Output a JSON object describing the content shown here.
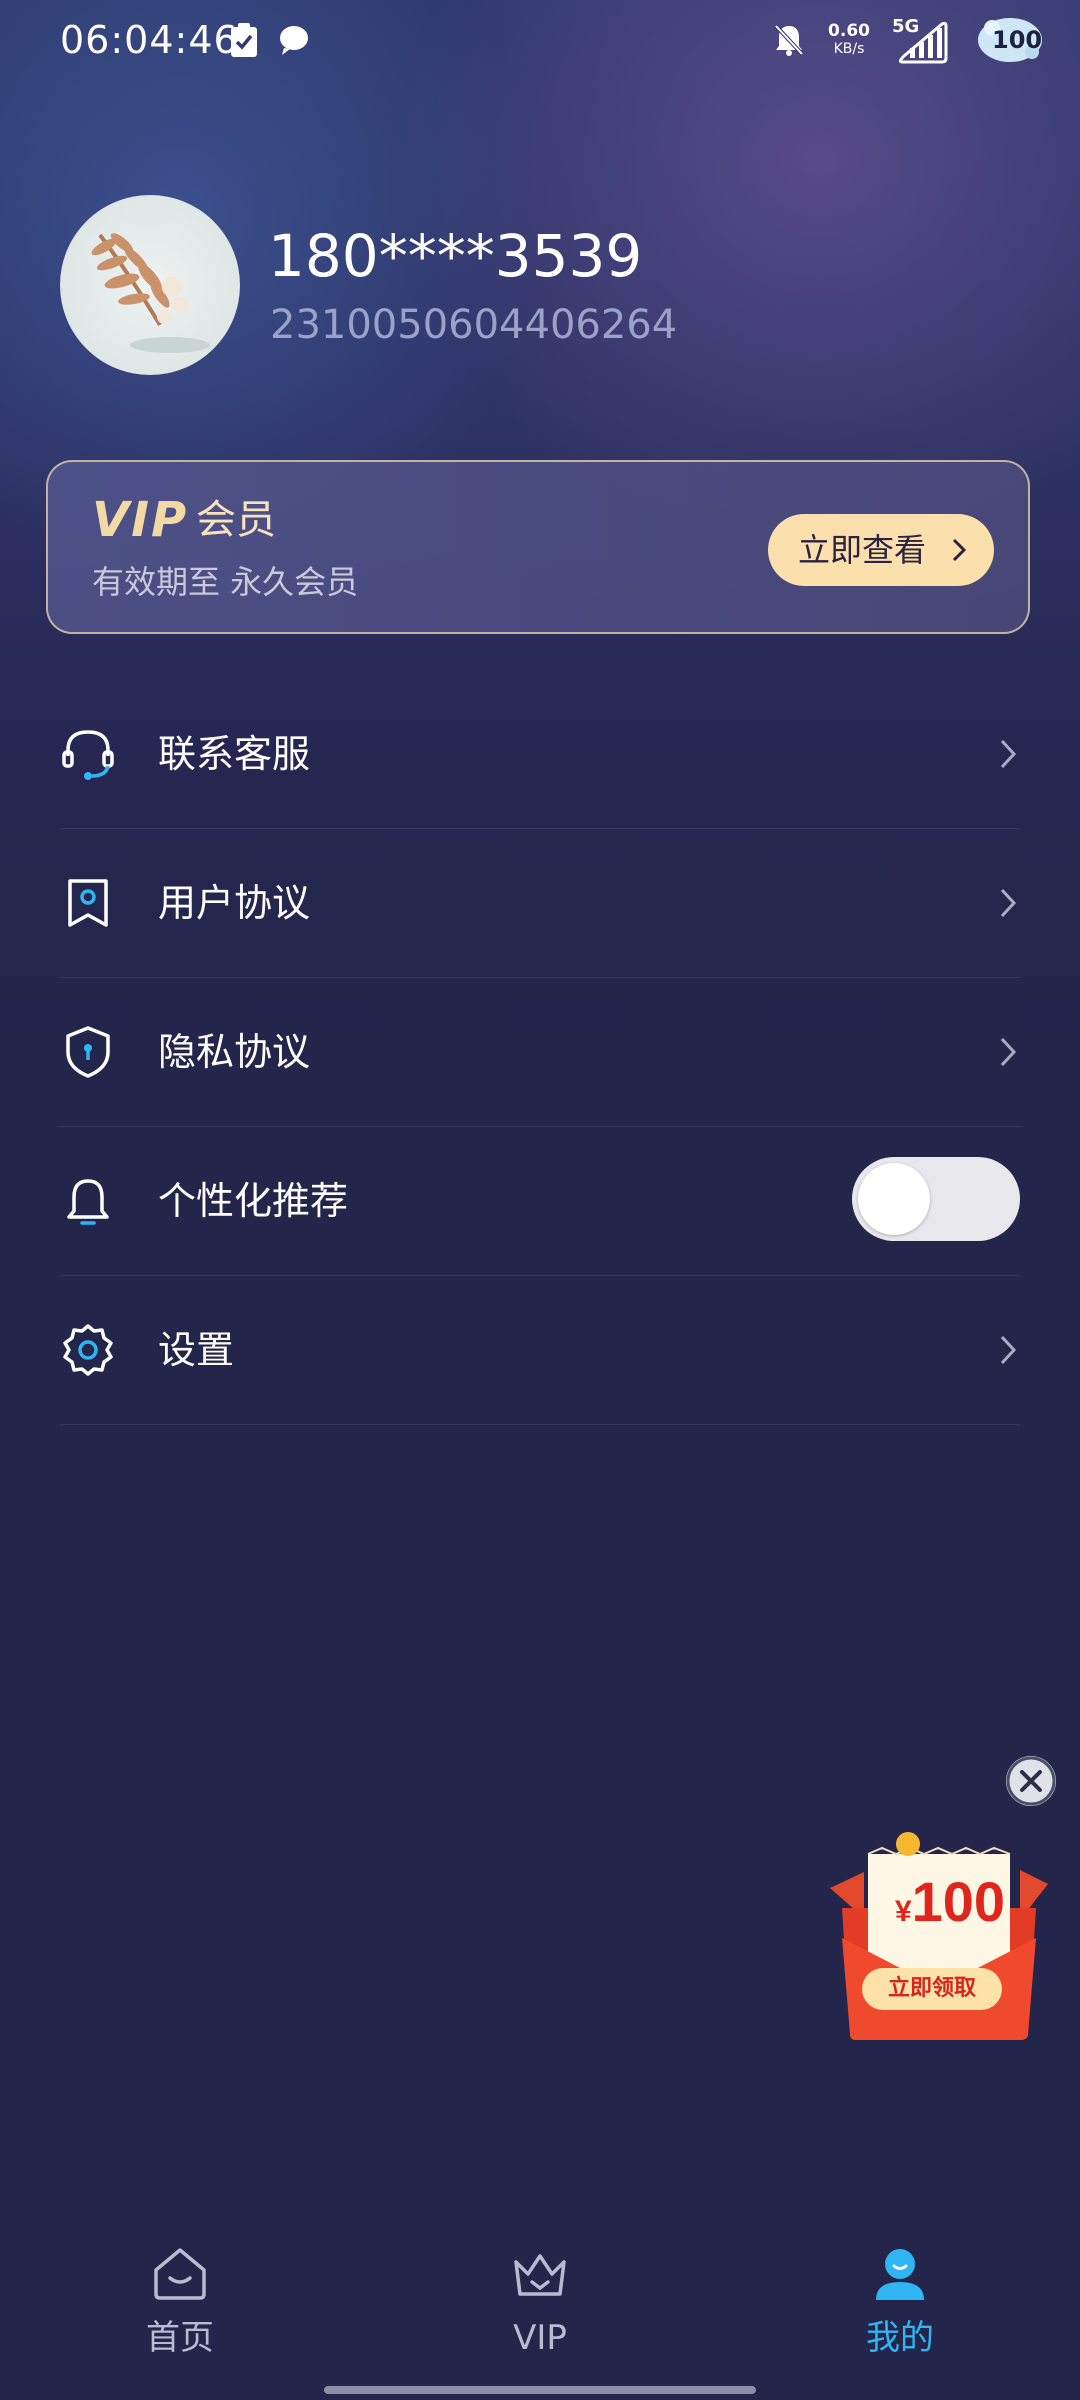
{
  "status_bar": {
    "time": "06:04:46",
    "net_speed_value": "0.60",
    "net_speed_unit": "KB/s",
    "network": "5G",
    "battery": "100",
    "icons": [
      "clipboard-check-icon",
      "chat-bubble-icon",
      "mute-bell-icon",
      "signal-icon",
      "battery-icon"
    ]
  },
  "profile": {
    "phone": "180****3539",
    "user_id": "2310050604406264"
  },
  "vip_card": {
    "logo": "VIP",
    "title": "会员",
    "expiry": "有效期至 永久会员",
    "button_label": "立即查看"
  },
  "menu": {
    "items": [
      {
        "label": "联系客服",
        "icon": "headset-icon"
      },
      {
        "label": "用户协议",
        "icon": "bookmark-icon"
      },
      {
        "label": "隐私协议",
        "icon": "shield-icon"
      },
      {
        "label": "个性化推荐",
        "icon": "bell-icon",
        "toggle": false
      },
      {
        "label": "设置",
        "icon": "gear-icon"
      }
    ]
  },
  "promo": {
    "currency": "¥",
    "amount": "100",
    "button_label": "立即领取"
  },
  "bottom_nav": {
    "items": [
      {
        "label": "首页",
        "icon": "home-icon",
        "active": false
      },
      {
        "label": "VIP",
        "icon": "crown-icon",
        "active": false
      },
      {
        "label": "我的",
        "icon": "user-icon",
        "active": true
      }
    ]
  },
  "colors": {
    "background": "#24254a",
    "accent": "#2fb6f2",
    "vip_gold": "#f3d9a4",
    "vip_button": "#fbe0ae",
    "promo_red": "#e0251c"
  }
}
